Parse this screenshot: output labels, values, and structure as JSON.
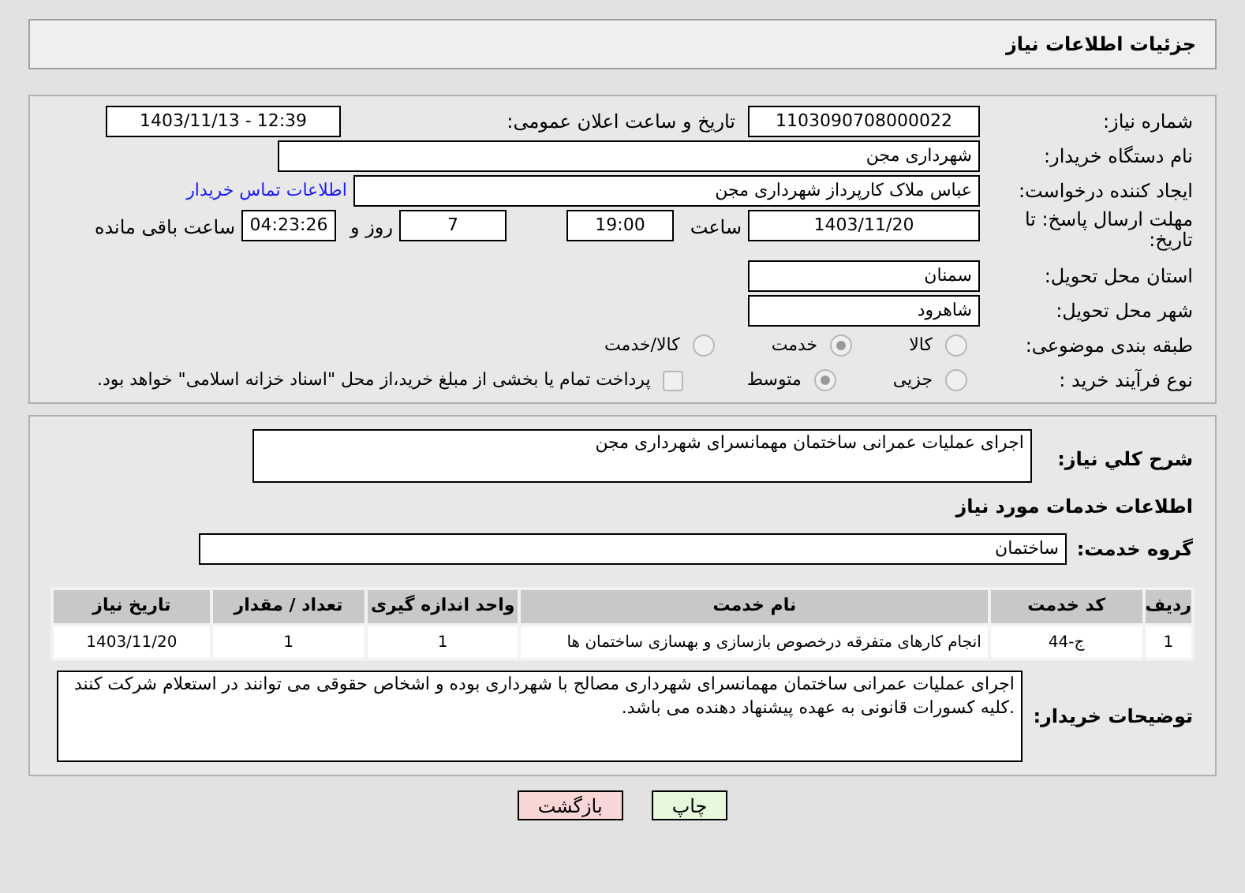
{
  "page_title": "جزئیات اطلاعات نیاز",
  "need_number": {
    "label": "شماره نیاز:",
    "value": "1103090708000022"
  },
  "announce": {
    "label": "تاریخ و ساعت اعلان عمومی:",
    "value": "1403/11/13 - 12:39"
  },
  "buyer_org": {
    "label": "نام دستگاه خریدار:",
    "value": "شهرداری مجن"
  },
  "requester": {
    "label": "ایجاد کننده درخواست:",
    "value": "عباس ملاک کارپرداز شهرداری مجن",
    "link": "اطلاعات تماس خریدار"
  },
  "deadline": {
    "label": "مهلت ارسال پاسخ: تا تاریخ:",
    "date": "1403/11/20",
    "time_label": "ساعت",
    "time": "19:00",
    "days": "7",
    "days_label": "روز و",
    "remaining": "04:23:26",
    "remaining_label": "ساعت باقی مانده"
  },
  "province": {
    "label": "استان محل تحویل:",
    "value": "سمنان"
  },
  "city": {
    "label": "شهر محل تحویل:",
    "value": "شاهرود"
  },
  "category": {
    "label": "طبقه بندی موضوعی:",
    "options": [
      {
        "label": "کالا",
        "selected": false
      },
      {
        "label": "خدمت",
        "selected": true
      },
      {
        "label": "کالا/خدمت",
        "selected": false
      }
    ]
  },
  "purchase_type": {
    "label": "نوع فرآیند خرید :",
    "options": [
      {
        "label": "جزیی",
        "selected": false
      },
      {
        "label": "متوسط",
        "selected": true
      }
    ],
    "payment": {
      "label": "پرداخت تمام یا بخشی از مبلغ خرید،از محل \"اسناد خزانه اسلامی\" خواهد بود.",
      "checked": false
    }
  },
  "description": {
    "label": "شرح کلي نياز:",
    "value": "اجرای عملیات عمرانی ساختمان مهمانسرای شهرداری مجن"
  },
  "services_heading": "اطلاعات خدمات مورد نیاز",
  "service_group": {
    "label": "گروه خدمت:",
    "value": "ساختمان"
  },
  "table": {
    "columns": [
      "ردیف",
      "کد خدمت",
      "نام خدمت",
      "واحد اندازه گیری",
      "تعداد / مقدار",
      "تاریخ نیاز"
    ],
    "rows": [
      [
        "1",
        "ج-44",
        "انجام کارهای متفرقه درخصوص بازسازی و بهسازی ساختمان ها",
        "1",
        "1",
        "1403/11/20"
      ]
    ]
  },
  "buyer_notes": {
    "label": "توضیحات خریدار:",
    "value": "اجرای عملیات عمرانی ساختمان مهمانسرای شهرداری مصالح با شهرداری بوده و اشخاص حقوقی می توانند در استعلام شرکت کنند .کلیه کسورات قانونی به عهده پیشنهاد دهنده می باشد."
  },
  "buttons": [
    {
      "label": "چاپ",
      "kind": "print"
    },
    {
      "label": "بازگشت",
      "kind": "back"
    }
  ]
}
